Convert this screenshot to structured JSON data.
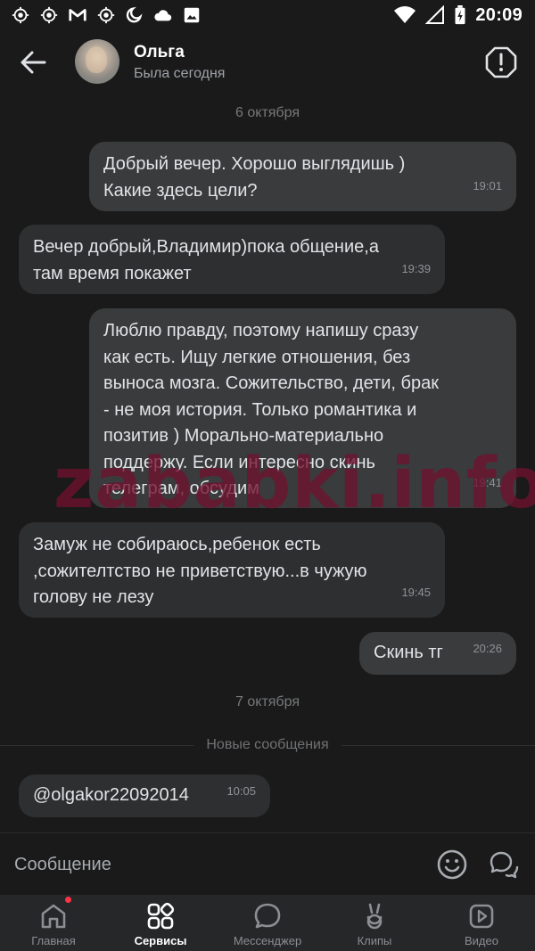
{
  "status_bar": {
    "time": "20:09",
    "icons_left": [
      "app-icon",
      "app-icon",
      "gmail-icon",
      "app-icon",
      "moon-icon",
      "cloud-icon",
      "image-icon"
    ],
    "icons_right": [
      "wifi-icon",
      "signal-icon",
      "battery-icon"
    ]
  },
  "header": {
    "name": "Ольга",
    "status": "Была сегодня"
  },
  "messages": {
    "date1": "6 октября",
    "m1": {
      "line1": "Добрый вечер. Хорошо выглядишь )",
      "line2": "Какие здесь цели?",
      "time": "19:01"
    },
    "m2": {
      "line1": "Вечер добрый,Владимир)пока общение,а",
      "line2": "там время покажет",
      "time": "19:39"
    },
    "m3": {
      "lines": [
        "Люблю правду, поэтому напишу сразу",
        "как есть. Ищу легкие отношения, без",
        "выноса мозга. Сожительство, дети, брак",
        "- не моя история. Только романтика и",
        "позитив ) Морально-материально",
        "поддержу. Если интересно скинь",
        "телеграм, обсудим"
      ],
      "time": "19:41"
    },
    "m4": {
      "lines": [
        "Замуж не собираюсь,ребенок есть",
        ",сожителтство не приветствую...в чужую",
        "голову не лезу"
      ],
      "time": "19:45"
    },
    "m5": {
      "text": "Скинь тг",
      "time": "20:26"
    },
    "date2": "7 октября",
    "new_label": "Новые сообщения",
    "m6": {
      "text": "@olgakor22092014",
      "time": "10:05"
    }
  },
  "watermark": "zababki.info",
  "input": {
    "placeholder": "Сообщение"
  },
  "nav": {
    "items": [
      {
        "label": "Главная",
        "icon": "home-icon"
      },
      {
        "label": "Сервисы",
        "icon": "grid-icon"
      },
      {
        "label": "Мессенджер",
        "icon": "chat-icon"
      },
      {
        "label": "Клипы",
        "icon": "clips-icon"
      },
      {
        "label": "Видео",
        "icon": "video-icon"
      }
    ],
    "active": "Сервисы"
  },
  "colors": {
    "accent_badge": "#ff3347",
    "background": "#1a1a1a",
    "bubble_in": "#2e2f30",
    "bubble_out": "#3a3b3c"
  }
}
